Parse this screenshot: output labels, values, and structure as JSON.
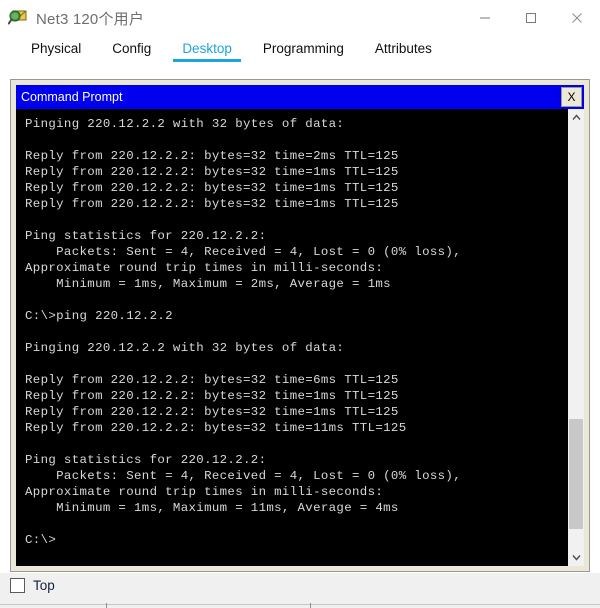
{
  "window": {
    "title": "Net3 120个用户",
    "icon": "packet-tracer-icon",
    "controls": {
      "minimize": "minimize-icon",
      "maximize": "maximize-icon",
      "close": "close-icon"
    }
  },
  "tabs": [
    {
      "label": "Physical",
      "active": false
    },
    {
      "label": "Config",
      "active": false
    },
    {
      "label": "Desktop",
      "active": true
    },
    {
      "label": "Programming",
      "active": false
    },
    {
      "label": "Attributes",
      "active": false
    }
  ],
  "command_prompt": {
    "title": "Command Prompt",
    "close_label": "X",
    "terminal_text": "Pinging 220.12.2.2 with 32 bytes of data:\n\nReply from 220.12.2.2: bytes=32 time=2ms TTL=125\nReply from 220.12.2.2: bytes=32 time=1ms TTL=125\nReply from 220.12.2.2: bytes=32 time=1ms TTL=125\nReply from 220.12.2.2: bytes=32 time=1ms TTL=125\n\nPing statistics for 220.12.2.2:\n    Packets: Sent = 4, Received = 4, Lost = 0 (0% loss),\nApproximate round trip times in milli-seconds:\n    Minimum = 1ms, Maximum = 2ms, Average = 1ms\n\nC:\\>ping 220.12.2.2\n\nPinging 220.12.2.2 with 32 bytes of data:\n\nReply from 220.12.2.2: bytes=32 time=6ms TTL=125\nReply from 220.12.2.2: bytes=32 time=1ms TTL=125\nReply from 220.12.2.2: bytes=32 time=1ms TTL=125\nReply from 220.12.2.2: bytes=32 time=11ms TTL=125\n\nPing statistics for 220.12.2.2:\n    Packets: Sent = 4, Received = 4, Lost = 0 (0% loss),\nApproximate round trip times in milli-seconds:\n    Minimum = 1ms, Maximum = 11ms, Average = 4ms\n\nC:\\>",
    "scrollbar": {
      "up_arrow": "chevron-up-icon",
      "down_arrow": "chevron-down-icon"
    }
  },
  "footer": {
    "top_checkbox_label": "Top",
    "top_checkbox_checked": false
  },
  "colors": {
    "accent": "#1ca4e0",
    "cmd_titlebar": "#0000ee",
    "panel_bg": "#ebe8d9",
    "terminal_bg": "#000000",
    "terminal_fg": "#d8d8d8"
  }
}
